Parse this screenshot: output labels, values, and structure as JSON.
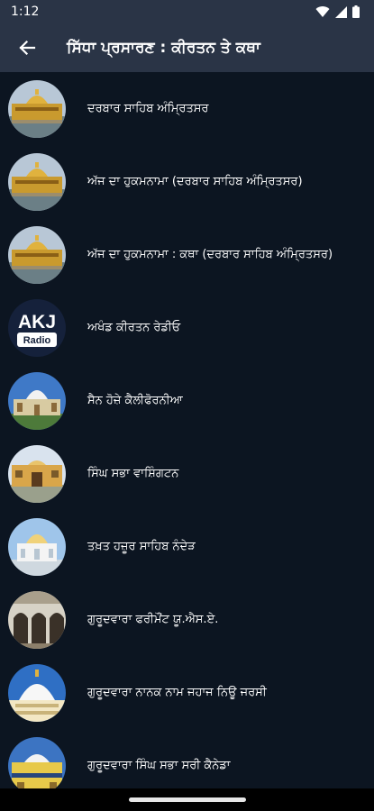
{
  "status_bar": {
    "time": "1:12",
    "icons": [
      "wifi-icon",
      "cellular-signal-icon",
      "battery-icon"
    ]
  },
  "app_bar": {
    "back_icon": "arrow-left-icon",
    "title": "ਸਿੱਧਾ ਪ੍ਰਸਾਰਣ : ਕੀਰਤਨ ਤੇ ਕਥਾ"
  },
  "stations": [
    {
      "label": "ਦਰਬਾਰ ਸਾਹਿਬ ਅੰਮ੍ਰਿਤਸਰ",
      "thumb": "golden-temple"
    },
    {
      "label": "ਅੱਜ ਦਾ ਹੁਕਮਨਾਮਾ (ਦਰਬਾਰ ਸਾਹਿਬ ਅੰਮ੍ਰਿਤਸਰ)",
      "thumb": "golden-temple"
    },
    {
      "label": "ਅੱਜ ਦਾ ਹੁਕਮਨਾਮਾ : ਕਥਾ  (ਦਰਬਾਰ ਸਾਹਿਬ ਅੰਮ੍ਰਿਤਸਰ)",
      "thumb": "golden-temple"
    },
    {
      "label": "ਅਖੰਡ ਕੀਰਤਨ ਰੇਡੀਓ",
      "thumb": "akj-radio",
      "logo_text": "AKJ",
      "logo_badge": "Radio"
    },
    {
      "label": "ਸੈਨ ਹੋਜ਼ੇ ਕੈਲੀਫੋਰਨੀਆ",
      "thumb": "domed-gurdwara"
    },
    {
      "label": "ਸਿੰਘ ਸਭਾ ਵਾਸ਼ਿੰਗਟਨ",
      "thumb": "gurdwara-entrance"
    },
    {
      "label": "ਤਖ਼ਤ ਹਜ਼ੂਰ ਸਾਹਿਬ ਨੰਦੇੜ",
      "thumb": "white-gurdwara"
    },
    {
      "label": "ਗੁਰੂਦਵਾਰਾ ਫਰੀਮੌਂਟ ਯੂ.ਐਸ.ਏ.",
      "thumb": "arched-hall"
    },
    {
      "label": "ਗੁਰੂਦਵਾਰਾ ਨਾਨਕ ਨਾਮ ਜਹਾਜ ਨਿਊ ਜਰਸੀ",
      "thumb": "white-dome"
    },
    {
      "label": "ਗੁਰੂਦਵਾਰਾ ਸਿੰਘ ਸਭਾ ਸਰੀ ਕੈਨੇਡਾ",
      "thumb": "yellow-gurdwara"
    }
  ],
  "nav_bar": {
    "home_indicator": "home-pill"
  }
}
